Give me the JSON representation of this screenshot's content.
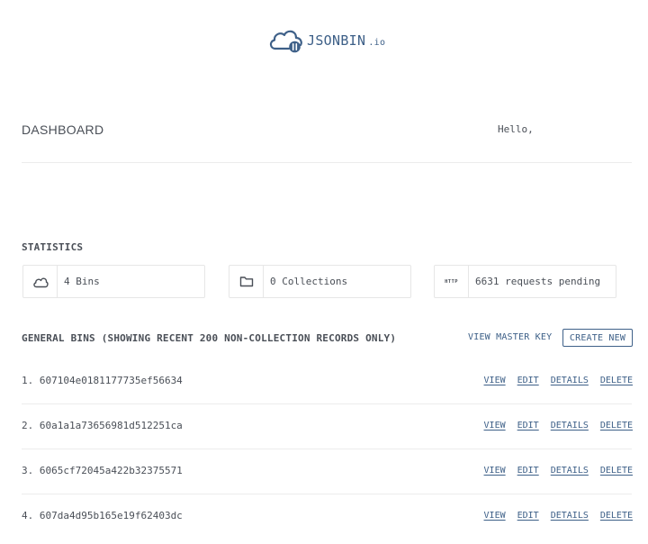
{
  "logo": {
    "name": "JSONBIN",
    "suffix": ".io",
    "brand_color": "#3e6088"
  },
  "dashboard": {
    "title": "DASHBOARD",
    "greeting": "Hello,"
  },
  "statistics": {
    "heading": "STATISTICS",
    "cards": [
      {
        "icon": "cloud-icon",
        "text": "4 Bins"
      },
      {
        "icon": "folder-icon",
        "text": "0 Collections"
      },
      {
        "icon": "http-icon",
        "badge": "HTTP",
        "text": "6631 requests pending"
      }
    ]
  },
  "bins": {
    "heading": "GENERAL BINS (SHOWING RECENT 200 NON-COLLECTION RECORDS ONLY)",
    "view_master_key": "VIEW MASTER KEY",
    "create_new": "CREATE NEW",
    "actions": {
      "view": "VIEW",
      "edit": "EDIT",
      "details": "DETAILS",
      "delete": "DELETE"
    },
    "items": [
      {
        "label": "1. 607104e0181177735ef56634"
      },
      {
        "label": "2. 60a1a1a73656981d512251ca"
      },
      {
        "label": "3. 6065cf72045a422b32375571"
      },
      {
        "label": "4. 607da4d95b165e19f62403dc"
      }
    ]
  }
}
